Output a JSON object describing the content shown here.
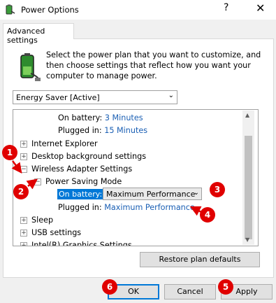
{
  "window": {
    "title": "Power Options",
    "help": "?",
    "close": "✕"
  },
  "tab": {
    "label": "Advanced settings"
  },
  "description": "Select the power plan that you want to customize, and then choose settings that reflect how you want your computer to manage power.",
  "plan": {
    "selected": "Energy Saver [Active]"
  },
  "tree": {
    "on_battery_label": "On battery:",
    "on_battery_value": "3 Minutes",
    "plugged_in_label": "Plugged in:",
    "plugged_in_value": "15 Minutes",
    "items": [
      "Internet Explorer",
      "Desktop background settings",
      "Wireless Adapter Settings"
    ],
    "sub_item": "Power Saving Mode",
    "psm_on_battery_label": "On battery:",
    "psm_on_battery_value": "Maximum Performance",
    "psm_plugged_in_label": "Plugged in:",
    "psm_plugged_in_value": "Maximum Performance",
    "items_after": [
      "Sleep",
      "USB settings",
      "Intel(R) Graphics Settings"
    ]
  },
  "buttons": {
    "restore": "Restore plan defaults",
    "ok": "OK",
    "cancel": "Cancel",
    "apply": "Apply"
  },
  "annotations": [
    "1",
    "2",
    "3",
    "4",
    "5",
    "6"
  ],
  "colors": {
    "accent": "#0078d7",
    "link": "#1a5fb4",
    "annotation": "#e00000"
  }
}
